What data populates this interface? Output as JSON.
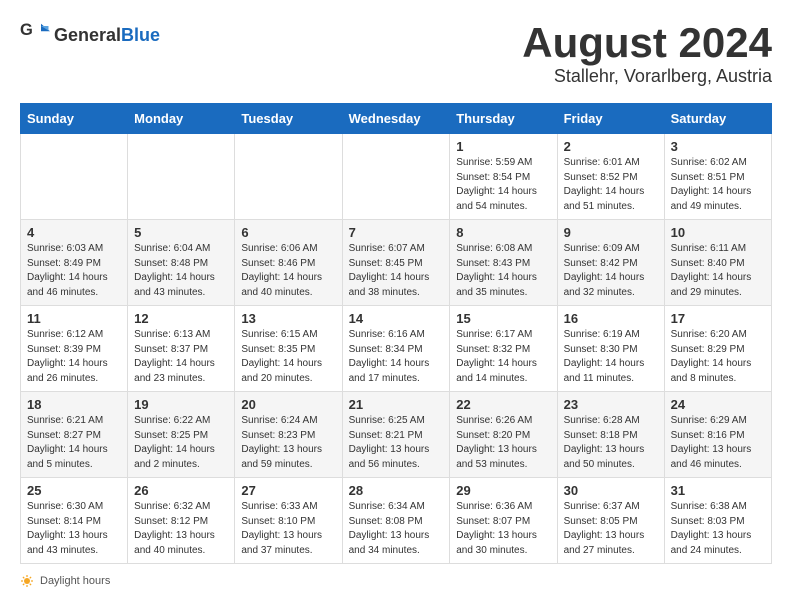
{
  "header": {
    "logo_general": "General",
    "logo_blue": "Blue",
    "month_year": "August 2024",
    "location": "Stallehr, Vorarlberg, Austria"
  },
  "days_of_week": [
    "Sunday",
    "Monday",
    "Tuesday",
    "Wednesday",
    "Thursday",
    "Friday",
    "Saturday"
  ],
  "weeks": [
    [
      {
        "day": "",
        "sunrise": "",
        "sunset": "",
        "daylight": ""
      },
      {
        "day": "",
        "sunrise": "",
        "sunset": "",
        "daylight": ""
      },
      {
        "day": "",
        "sunrise": "",
        "sunset": "",
        "daylight": ""
      },
      {
        "day": "",
        "sunrise": "",
        "sunset": "",
        "daylight": ""
      },
      {
        "day": "1",
        "sunrise": "Sunrise: 5:59 AM",
        "sunset": "Sunset: 8:54 PM",
        "daylight": "Daylight: 14 hours and 54 minutes."
      },
      {
        "day": "2",
        "sunrise": "Sunrise: 6:01 AM",
        "sunset": "Sunset: 8:52 PM",
        "daylight": "Daylight: 14 hours and 51 minutes."
      },
      {
        "day": "3",
        "sunrise": "Sunrise: 6:02 AM",
        "sunset": "Sunset: 8:51 PM",
        "daylight": "Daylight: 14 hours and 49 minutes."
      }
    ],
    [
      {
        "day": "4",
        "sunrise": "Sunrise: 6:03 AM",
        "sunset": "Sunset: 8:49 PM",
        "daylight": "Daylight: 14 hours and 46 minutes."
      },
      {
        "day": "5",
        "sunrise": "Sunrise: 6:04 AM",
        "sunset": "Sunset: 8:48 PM",
        "daylight": "Daylight: 14 hours and 43 minutes."
      },
      {
        "day": "6",
        "sunrise": "Sunrise: 6:06 AM",
        "sunset": "Sunset: 8:46 PM",
        "daylight": "Daylight: 14 hours and 40 minutes."
      },
      {
        "day": "7",
        "sunrise": "Sunrise: 6:07 AM",
        "sunset": "Sunset: 8:45 PM",
        "daylight": "Daylight: 14 hours and 38 minutes."
      },
      {
        "day": "8",
        "sunrise": "Sunrise: 6:08 AM",
        "sunset": "Sunset: 8:43 PM",
        "daylight": "Daylight: 14 hours and 35 minutes."
      },
      {
        "day": "9",
        "sunrise": "Sunrise: 6:09 AM",
        "sunset": "Sunset: 8:42 PM",
        "daylight": "Daylight: 14 hours and 32 minutes."
      },
      {
        "day": "10",
        "sunrise": "Sunrise: 6:11 AM",
        "sunset": "Sunset: 8:40 PM",
        "daylight": "Daylight: 14 hours and 29 minutes."
      }
    ],
    [
      {
        "day": "11",
        "sunrise": "Sunrise: 6:12 AM",
        "sunset": "Sunset: 8:39 PM",
        "daylight": "Daylight: 14 hours and 26 minutes."
      },
      {
        "day": "12",
        "sunrise": "Sunrise: 6:13 AM",
        "sunset": "Sunset: 8:37 PM",
        "daylight": "Daylight: 14 hours and 23 minutes."
      },
      {
        "day": "13",
        "sunrise": "Sunrise: 6:15 AM",
        "sunset": "Sunset: 8:35 PM",
        "daylight": "Daylight: 14 hours and 20 minutes."
      },
      {
        "day": "14",
        "sunrise": "Sunrise: 6:16 AM",
        "sunset": "Sunset: 8:34 PM",
        "daylight": "Daylight: 14 hours and 17 minutes."
      },
      {
        "day": "15",
        "sunrise": "Sunrise: 6:17 AM",
        "sunset": "Sunset: 8:32 PM",
        "daylight": "Daylight: 14 hours and 14 minutes."
      },
      {
        "day": "16",
        "sunrise": "Sunrise: 6:19 AM",
        "sunset": "Sunset: 8:30 PM",
        "daylight": "Daylight: 14 hours and 11 minutes."
      },
      {
        "day": "17",
        "sunrise": "Sunrise: 6:20 AM",
        "sunset": "Sunset: 8:29 PM",
        "daylight": "Daylight: 14 hours and 8 minutes."
      }
    ],
    [
      {
        "day": "18",
        "sunrise": "Sunrise: 6:21 AM",
        "sunset": "Sunset: 8:27 PM",
        "daylight": "Daylight: 14 hours and 5 minutes."
      },
      {
        "day": "19",
        "sunrise": "Sunrise: 6:22 AM",
        "sunset": "Sunset: 8:25 PM",
        "daylight": "Daylight: 14 hours and 2 minutes."
      },
      {
        "day": "20",
        "sunrise": "Sunrise: 6:24 AM",
        "sunset": "Sunset: 8:23 PM",
        "daylight": "Daylight: 13 hours and 59 minutes."
      },
      {
        "day": "21",
        "sunrise": "Sunrise: 6:25 AM",
        "sunset": "Sunset: 8:21 PM",
        "daylight": "Daylight: 13 hours and 56 minutes."
      },
      {
        "day": "22",
        "sunrise": "Sunrise: 6:26 AM",
        "sunset": "Sunset: 8:20 PM",
        "daylight": "Daylight: 13 hours and 53 minutes."
      },
      {
        "day": "23",
        "sunrise": "Sunrise: 6:28 AM",
        "sunset": "Sunset: 8:18 PM",
        "daylight": "Daylight: 13 hours and 50 minutes."
      },
      {
        "day": "24",
        "sunrise": "Sunrise: 6:29 AM",
        "sunset": "Sunset: 8:16 PM",
        "daylight": "Daylight: 13 hours and 46 minutes."
      }
    ],
    [
      {
        "day": "25",
        "sunrise": "Sunrise: 6:30 AM",
        "sunset": "Sunset: 8:14 PM",
        "daylight": "Daylight: 13 hours and 43 minutes."
      },
      {
        "day": "26",
        "sunrise": "Sunrise: 6:32 AM",
        "sunset": "Sunset: 8:12 PM",
        "daylight": "Daylight: 13 hours and 40 minutes."
      },
      {
        "day": "27",
        "sunrise": "Sunrise: 6:33 AM",
        "sunset": "Sunset: 8:10 PM",
        "daylight": "Daylight: 13 hours and 37 minutes."
      },
      {
        "day": "28",
        "sunrise": "Sunrise: 6:34 AM",
        "sunset": "Sunset: 8:08 PM",
        "daylight": "Daylight: 13 hours and 34 minutes."
      },
      {
        "day": "29",
        "sunrise": "Sunrise: 6:36 AM",
        "sunset": "Sunset: 8:07 PM",
        "daylight": "Daylight: 13 hours and 30 minutes."
      },
      {
        "day": "30",
        "sunrise": "Sunrise: 6:37 AM",
        "sunset": "Sunset: 8:05 PM",
        "daylight": "Daylight: 13 hours and 27 minutes."
      },
      {
        "day": "31",
        "sunrise": "Sunrise: 6:38 AM",
        "sunset": "Sunset: 8:03 PM",
        "daylight": "Daylight: 13 hours and 24 minutes."
      }
    ]
  ],
  "footer": {
    "daylight_label": "Daylight hours"
  }
}
